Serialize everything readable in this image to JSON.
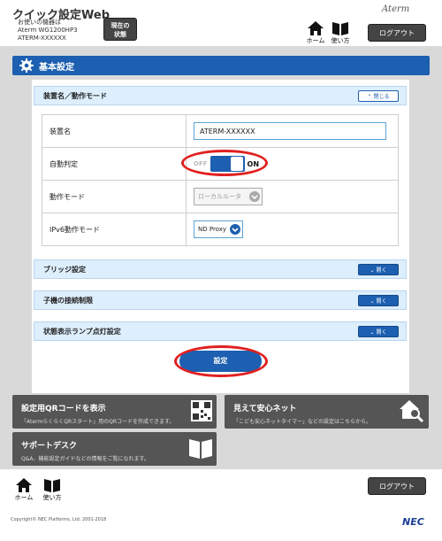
{
  "header": {
    "app_title": "クイック設定Web",
    "device_line1": "お使いの機器は",
    "device_line2": "Aterm WG1200HP3",
    "device_line3": "ATERM-XXXXXX",
    "status_button_line1": "現在の",
    "status_button_line2": "状態",
    "brand": "Aterm",
    "home_label": "ホーム",
    "howto_label": "使い方",
    "logout_label": "ログアウト"
  },
  "section": {
    "title": "基本設定"
  },
  "accordion_main": {
    "label": "装置名／動作モード",
    "close_label": "閉じる"
  },
  "settings": {
    "device_name_label": "装置名",
    "device_name_value": "ATERM-XXXXXX",
    "auto_detect_label": "自動判定",
    "toggle_off": "OFF",
    "toggle_on": "ON",
    "mode_label": "動作モード",
    "mode_value": "ローカルルータ",
    "ipv6_label": "IPv6動作モード",
    "ipv6_value": "ND Proxy"
  },
  "accordions": [
    {
      "label": "ブリッジ設定",
      "open_label": "開く"
    },
    {
      "label": "子機の接続制限",
      "open_label": "開く"
    },
    {
      "label": "状態表示ランプ点灯設定",
      "open_label": "開く"
    }
  ],
  "apply_label": "設定",
  "tiles": {
    "qr_title": "設定用QRコードを表示",
    "qr_desc": "「AtermらくらくQRスタート」用のQRコードを作成できます。",
    "safe_title": "見えて安心ネット",
    "safe_desc": "「こども安心ネットタイマー」などの設定はこちらから。",
    "support_title": "サポートデスク",
    "support_desc": "Q&A、機能設定ガイドなどの情報をご覧になれます。"
  },
  "footer": {
    "home_label": "ホーム",
    "howto_label": "使い方",
    "logout_label": "ログアウト",
    "copyright": "Copyright© NEC Platforms, Ltd. 2001-2018",
    "nec": "NEC"
  },
  "colors": {
    "accent": "#1d5fb0",
    "highlight": "#e02020",
    "tile": "#555555"
  }
}
